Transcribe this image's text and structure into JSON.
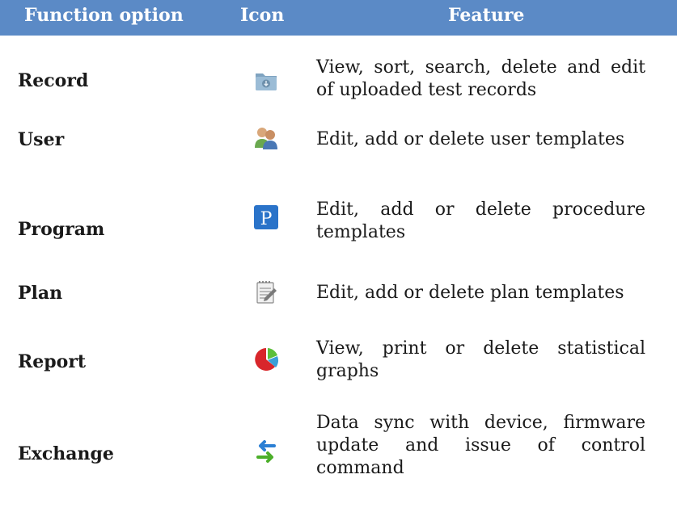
{
  "header": {
    "function_option": "Function option",
    "icon": "Icon",
    "feature": "Feature"
  },
  "rows": [
    {
      "function": "Record",
      "icon": "folder-download-icon",
      "feature": "View, sort, search, delete and edit of uploaded test records"
    },
    {
      "function": "User",
      "icon": "users-icon",
      "feature": "Edit, add or delete user templates"
    },
    {
      "function": "Program",
      "icon": "p-letter-icon",
      "feature": "Edit, add or delete procedure templates"
    },
    {
      "function": "Plan",
      "icon": "notepad-pencil-icon",
      "feature": "Edit, add or delete plan templates"
    },
    {
      "function": "Report",
      "icon": "pie-chart-icon",
      "feature": "View, print or delete statistical graphs"
    },
    {
      "function": "Exchange",
      "icon": "sync-arrows-icon",
      "feature": "Data sync with device, firmware update and issue of control command"
    }
  ],
  "colors": {
    "header_bg": "#5b8ac6",
    "header_text": "#ffffff",
    "p_icon_blue": "#2a73c9",
    "sync_blue": "#2b7fd4",
    "sync_green": "#4caf2a"
  }
}
